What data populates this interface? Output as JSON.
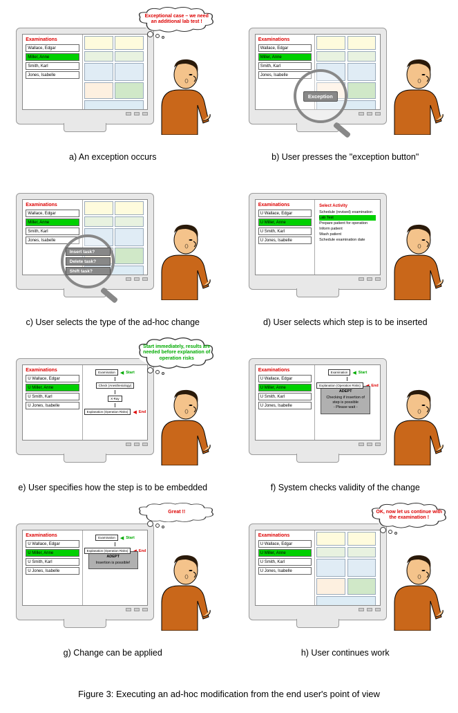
{
  "panels": [
    {
      "caption": "a) An exception occurs",
      "thought": {
        "text": "Exceptional case – we need an additional lab test !",
        "color": "red"
      },
      "patients_style": "short",
      "highlighted": 1,
      "right": "form"
    },
    {
      "caption": "b) User presses the \"exception button\"",
      "patients_style": "short",
      "highlighted": 1,
      "right": "form",
      "magnifier": {
        "type": "button",
        "label": "Exception"
      }
    },
    {
      "caption": "c) User selects the type of the ad-hoc change",
      "patients_style": "short",
      "highlighted": 1,
      "right": "form",
      "magnifier": {
        "type": "menu",
        "items": [
          "Insert task?",
          "Delete task?",
          "Shift task?"
        ]
      }
    },
    {
      "caption": "d) User selects which step is to be inserted",
      "patients_style": "long",
      "highlighted": 1,
      "right": "activities"
    },
    {
      "caption": "e) User specifies how the step is to be embedded",
      "thought": {
        "text": "Start immediately, results are needed before explanation of operation risks",
        "color": "green"
      },
      "patients_style": "long",
      "highlighted": 1,
      "right": "flow"
    },
    {
      "caption": "f) System checks validity of the change",
      "patients_style": "long",
      "highlighted": 1,
      "right": "flow",
      "dialog": {
        "title": "ADEPT",
        "lines": [
          "Checking if insertion of step is possible",
          "- Please wait -"
        ]
      }
    },
    {
      "caption": "g) Change can be applied",
      "thought": {
        "text": "Great !!",
        "color": "red"
      },
      "patients_style": "long",
      "highlighted": 1,
      "right": "flow",
      "dialog": {
        "title": "ADEPT",
        "lines": [
          "Insertion is possible!"
        ]
      }
    },
    {
      "caption": "h) User continues work",
      "thought": {
        "text": "OK, now let us continue with the examination !",
        "color": "red"
      },
      "patients_style": "long",
      "highlighted": 1,
      "right": "form"
    }
  ],
  "examinations_label": "Examinations",
  "patients_short": [
    "Wallace, Edgar",
    "Miller, Anne",
    "Smith, Karl",
    "Jones, Isabelle"
  ],
  "patients_long": [
    "U Wallace, Edgar",
    "U Miller, Anne",
    "U Smith, Karl",
    "U Jones, Isabelle"
  ],
  "activities": {
    "title": "Select Activity",
    "items": [
      "Schedule (revised) examination",
      "Lab Test",
      "Prepare patient for operation",
      "Inform patient",
      "Wash patient",
      "Schedule examination date"
    ],
    "highlight": 1
  },
  "flow": {
    "start": "Start",
    "end": "End",
    "boxes": [
      "Examination",
      "Check (Anesthesiology)",
      "X-Ray",
      "Explanation (Operation Risks)"
    ]
  },
  "figure_caption": "Figure 3: Executing an ad-hoc modification from the end user's point of view"
}
